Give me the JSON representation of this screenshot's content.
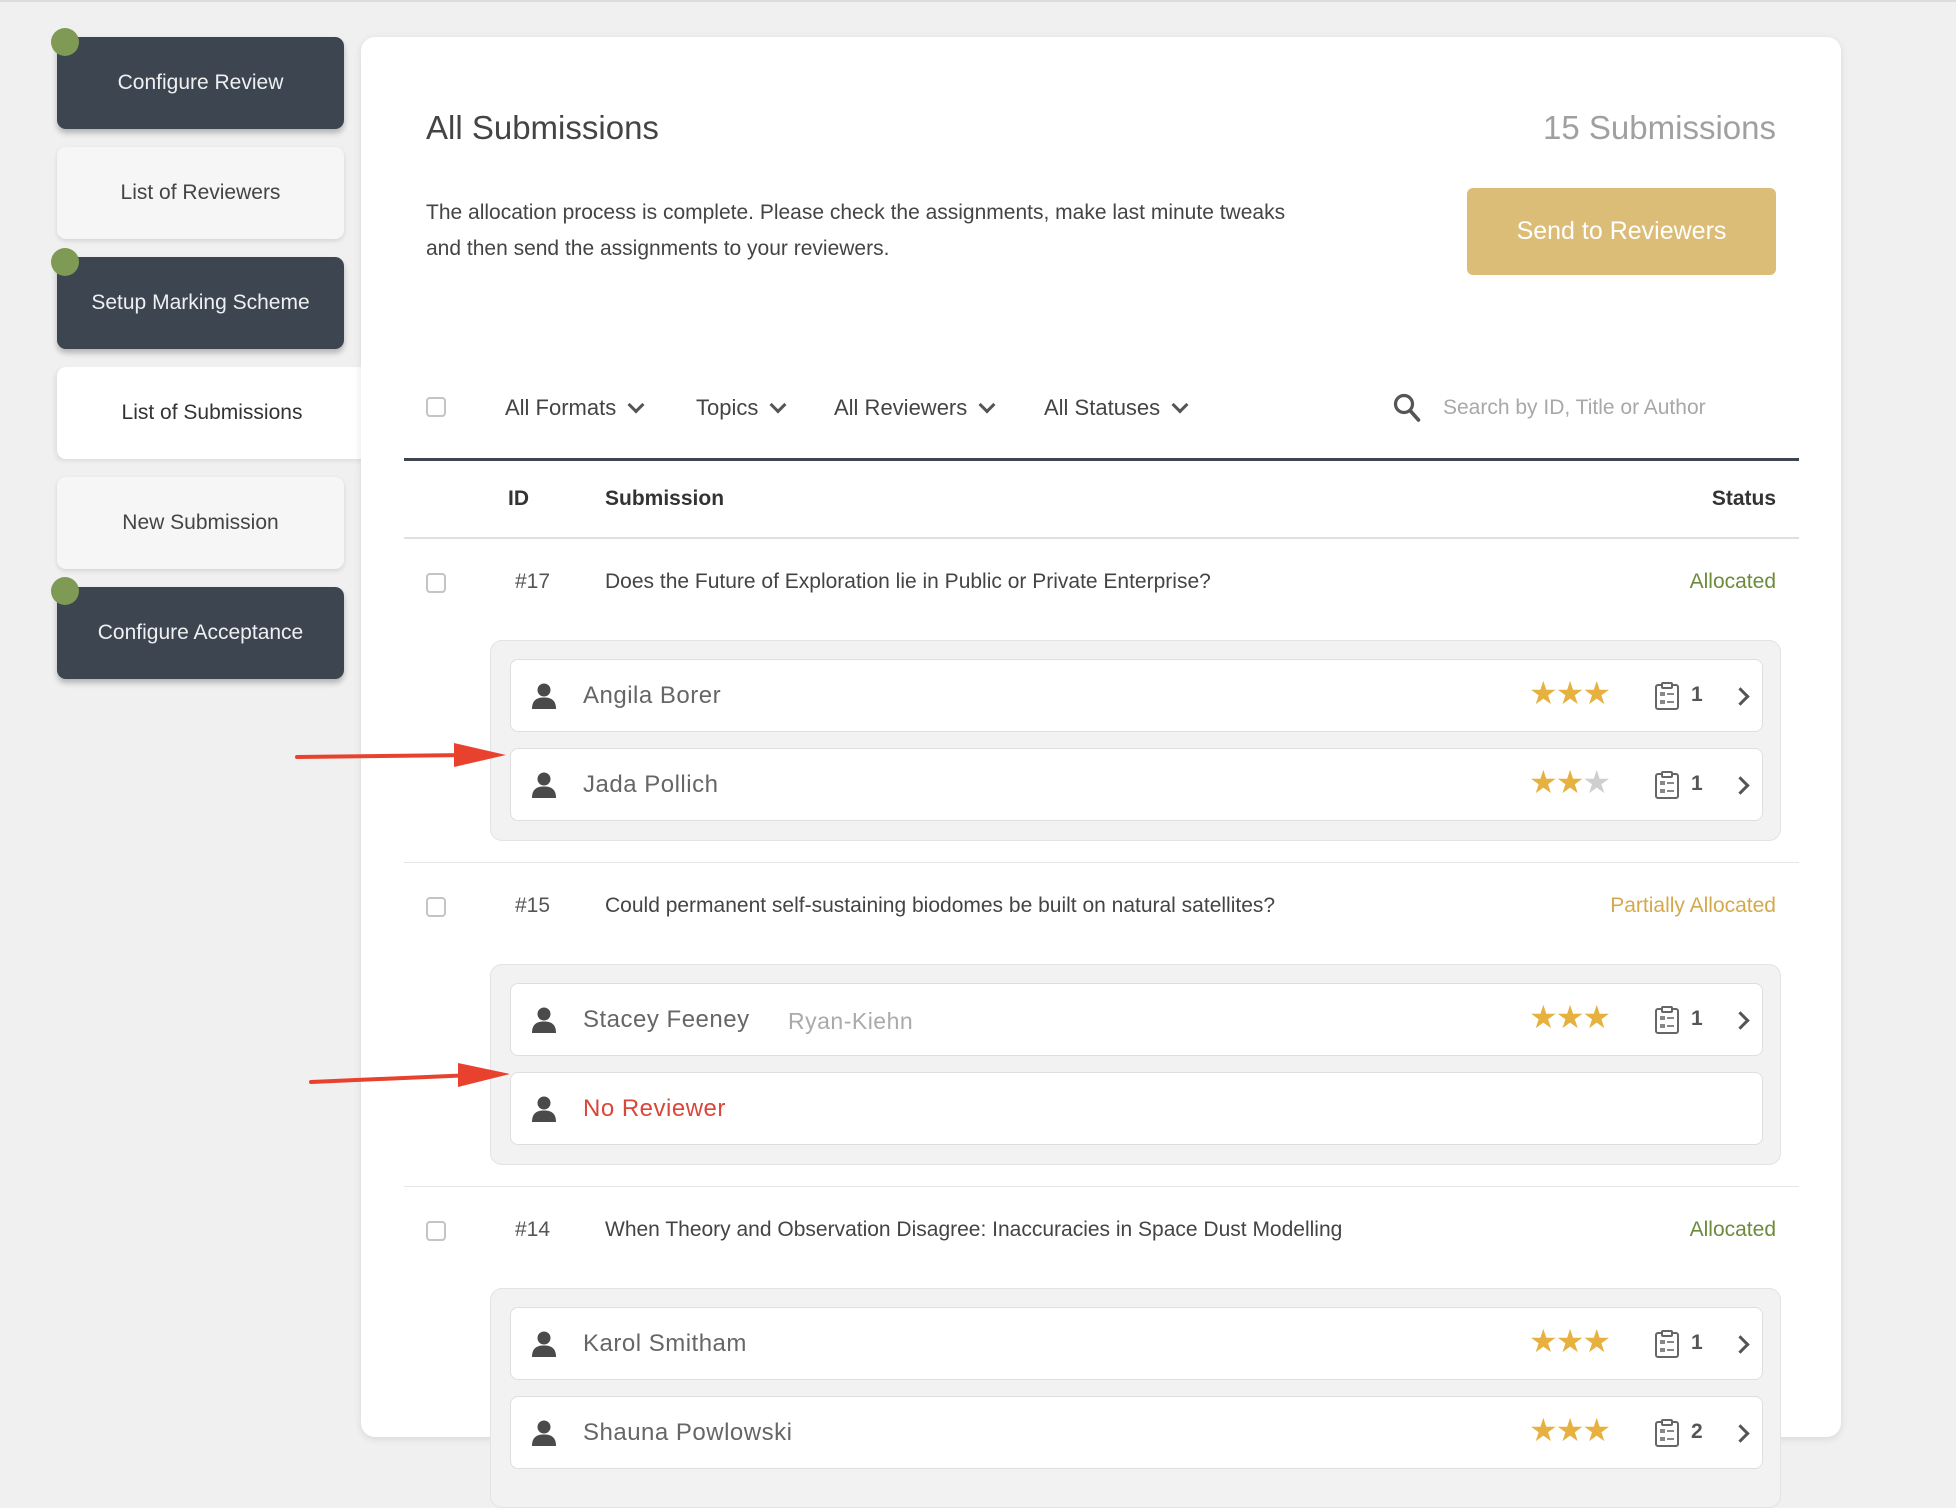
{
  "sidebar": {
    "items": [
      {
        "label": "Configure Review"
      },
      {
        "label": "List of Reviewers"
      },
      {
        "label": "Setup Marking Scheme"
      },
      {
        "label": "List of Submissions"
      },
      {
        "label": "New Submission"
      },
      {
        "label": "Configure Acceptance"
      }
    ]
  },
  "main": {
    "title": "All Submissions",
    "count": "15 Submissions",
    "intro": "The allocation process is complete. Please check the assignments, make last minute tweaks and then send the assignments to your reviewers.",
    "send_button": "Send to Reviewers",
    "filters": [
      "All Formats",
      "Topics",
      "All Reviewers",
      "All Statuses"
    ],
    "search_placeholder": "Search by ID, Title or Author",
    "columns": {
      "id": "ID",
      "submission": "Submission",
      "status": "Status"
    }
  },
  "submissions": [
    {
      "id": "#17",
      "title": "Does the Future of Exploration lie in Public or Private Enterprise?",
      "status": "Allocated",
      "reviewers": [
        {
          "name": "Angila Borer",
          "org": "",
          "stars": 3,
          "count": "1"
        },
        {
          "name": "Jada Pollich",
          "org": "",
          "stars": 2,
          "count": "1"
        }
      ]
    },
    {
      "id": "#15",
      "title": "Could permanent self-sustaining biodomes be built on natural satellites?",
      "status": "Partially Allocated",
      "reviewers": [
        {
          "name": "Stacey Feeney",
          "org": "Ryan-Kiehn",
          "stars": 3,
          "count": "1"
        },
        {
          "name": "No Reviewer"
        }
      ]
    },
    {
      "id": "#14",
      "title": "When Theory and Observation Disagree: Inaccuracies in Space Dust Modelling",
      "status": "Allocated",
      "reviewers": [
        {
          "name": "Karol Smitham",
          "org": "",
          "stars": 3,
          "count": "1"
        },
        {
          "name": "Shauna Powlowski",
          "org": "",
          "stars": 3,
          "count": "2"
        }
      ]
    }
  ],
  "colors": {
    "sidebar_dark": "#3d4550",
    "complete_dot": "#7e9a54",
    "send_button": "#dcbd78",
    "status_allocated": "#6d8a3d",
    "status_partial": "#d4a94c",
    "no_reviewer": "#d9473b",
    "star": "#e6b13e",
    "annotation_arrow": "#e8422e"
  },
  "icons": [
    "person-icon",
    "clipboard-icon",
    "star-icon",
    "chevron-right-icon",
    "chevron-down-icon",
    "search-icon",
    "annotation-arrow"
  ]
}
